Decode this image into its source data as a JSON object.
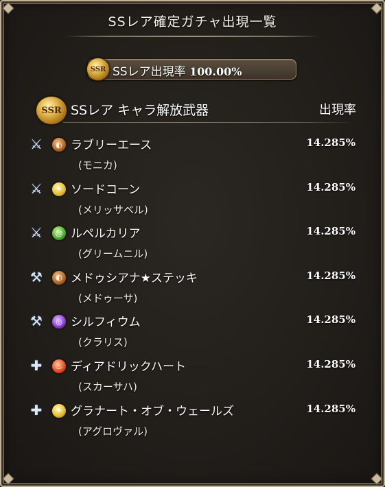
{
  "window": {
    "title": "SSレア確定ガチャ出現一覧"
  },
  "rate_summary": {
    "badge": "SSR",
    "label": "SSレア出現率",
    "value": "100.00%"
  },
  "section": {
    "badge": "SSR",
    "title": "SSレア キャラ解放武器",
    "rate_header": "出現率"
  },
  "items": [
    {
      "weapon": "ラブリーエース",
      "character": "(モニカ)",
      "rate": "14.285%",
      "element": "earth",
      "weapon_type": "sword-icon"
    },
    {
      "weapon": "ソードコーン",
      "character": "(メリッサベル)",
      "rate": "14.285%",
      "element": "light",
      "weapon_type": "sword-icon"
    },
    {
      "weapon": "ルペルカリア",
      "character": "(グリームニル)",
      "rate": "14.285%",
      "element": "wind",
      "weapon_type": "sword-icon"
    },
    {
      "weapon": "メドゥシアナ★ステッキ",
      "character": "(メドゥーサ)",
      "rate": "14.285%",
      "element": "earth",
      "weapon_type": "axe-icon"
    },
    {
      "weapon": "シルフィウム",
      "character": "(クラリス)",
      "rate": "14.285%",
      "element": "dark",
      "weapon_type": "axe-icon"
    },
    {
      "weapon": "ディアドリックハート",
      "character": "(スカーサハ)",
      "rate": "14.285%",
      "element": "fire",
      "weapon_type": "gun-icon"
    },
    {
      "weapon": "グラナート・オブ・ウェールズ",
      "character": "(アグロヴァル)",
      "rate": "14.285%",
      "element": "light",
      "weapon_type": "gun-icon"
    }
  ],
  "colors": {
    "background": "#221f1b",
    "frame": "#c2b49a",
    "text": "#ffffff",
    "badge_gold": "#e3b64a"
  }
}
